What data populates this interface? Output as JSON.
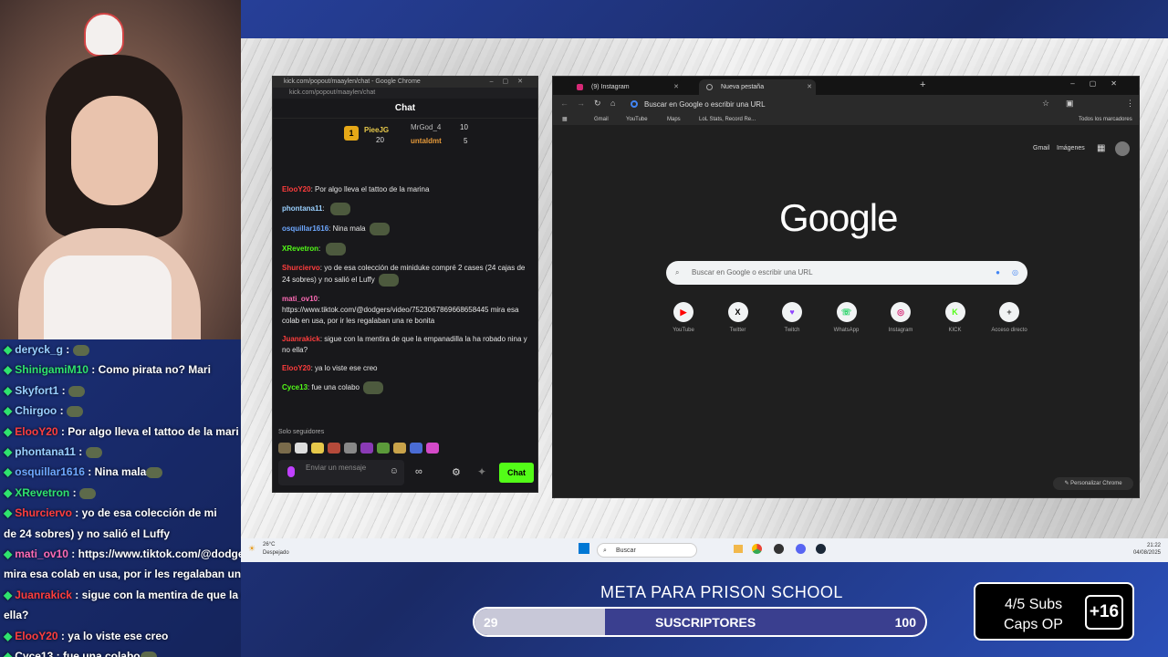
{
  "overlay_chat": [
    {
      "user": "deryck_g",
      "color": "#9ad0ff",
      "text": ""
    },
    {
      "user": "ShinigamiM10",
      "color": "#2fe36e",
      "text": "Como pirata no? Mari"
    },
    {
      "user": "Skyfort1",
      "color": "#9ad0ff",
      "text": ""
    },
    {
      "user": "Chirgoo",
      "color": "#9ad0ff",
      "text": ""
    },
    {
      "user": "ElooY20",
      "color": "#ff3d3d",
      "text": "Por algo lleva el tattoo de la mari"
    },
    {
      "user": "phontana11",
      "color": "#9ad0ff",
      "text": ""
    },
    {
      "user": "osquillar1616",
      "color": "#6ea8ff",
      "text": "Nina mala"
    },
    {
      "user": "XRevetron",
      "color": "#2fe36e",
      "text": ""
    },
    {
      "user": "Shurciervo",
      "color": "#ff3d3d",
      "text": "yo de esa colección de mi"
    },
    {
      "user": "",
      "color": "#fff",
      "text": "de 24 sobres) y no salió el Luffy"
    },
    {
      "user": "mati_ov10",
      "color": "#ff6bb5",
      "text": "https://www.tiktok.com/@dodger"
    },
    {
      "user": "",
      "color": "#fff",
      "text": "mira esa colab en usa, por ir les regalaban una"
    },
    {
      "user": "Juanrakick",
      "color": "#ff3d3d",
      "text": "sigue con la mentira de que la em"
    },
    {
      "user": "",
      "color": "#fff",
      "text": "ella?"
    },
    {
      "user": "ElooY20",
      "color": "#ff3d3d",
      "text": "ya lo viste ese creo"
    },
    {
      "user": "Cyce13",
      "color": "#fff",
      "text": "fue una colabo"
    }
  ],
  "kick_window": {
    "title": "kick.com/popout/maaylen/chat - Google Chrome",
    "url": "kick.com/popout/maaylen/chat",
    "chat_title": "Chat",
    "gifters": [
      {
        "name": "PieeJG",
        "count": "20",
        "rank": "1"
      },
      {
        "name": "MrGod_4",
        "count": "10"
      },
      {
        "name": "untaldmt",
        "count": "5"
      }
    ],
    "messages": [
      {
        "user": "ElooY20",
        "color": "#ff3d3d",
        "text": "Por algo lleva el tattoo de la marina"
      },
      {
        "user": "phontana11",
        "color": "#9ad0ff",
        "text": ""
      },
      {
        "user": "osquillar1616",
        "color": "#6ea8ff",
        "text": "Nina mala"
      },
      {
        "user": "XRevetron",
        "color": "#53fc18",
        "text": ""
      },
      {
        "user": "Shurciervo",
        "color": "#ff3d3d",
        "text": "yo de esa colección de miniduke compré 2 cases (24 cajas de 24 sobres) y no salió el Luffy"
      },
      {
        "user": "mati_ov10",
        "color": "#ff6bb5",
        "text": "https://www.tiktok.com/@dodgers/video/7523067869668658445 mira esa colab en usa, por ir les regalaban una re bonita"
      },
      {
        "user": "Juanrakick",
        "color": "#ff3d3d",
        "text": "sigue con la mentira de que la empanadilla la ha robado nina y no ella?"
      },
      {
        "user": "ElooY20",
        "color": "#ff3d3d",
        "text": "ya lo viste ese creo"
      },
      {
        "user": "Cyce13",
        "color": "#53fc18",
        "text": "fue una colabo"
      }
    ],
    "followers_only": "Solo seguidores",
    "input_placeholder": "Enviar un mensaje",
    "send_label": "Chat"
  },
  "chrome": {
    "tabs": [
      {
        "label": "(9) Instagram",
        "active": false
      },
      {
        "label": "Nueva pestaña",
        "active": true
      }
    ],
    "omnibox": "Buscar en Google o escribir una URL",
    "bookmarks": [
      "Gmail",
      "YouTube",
      "Maps",
      "LoL Stats, Record Re..."
    ],
    "bookmarks_all": "Todos los marcadores",
    "top_links": [
      "Gmail",
      "Imágenes"
    ],
    "search_placeholder": "Buscar en Google o escribir una URL",
    "logo": "Google",
    "shortcuts": [
      {
        "label": "YouTube",
        "color": "#ff0000",
        "glyph": "▶"
      },
      {
        "label": "Twitter",
        "color": "#000000",
        "glyph": "X"
      },
      {
        "label": "Twitch",
        "color": "#9146ff",
        "glyph": "♥"
      },
      {
        "label": "WhatsApp",
        "color": "#25d366",
        "glyph": "☏"
      },
      {
        "label": "Instagram",
        "color": "#d62976",
        "glyph": "◎"
      },
      {
        "label": "KICK",
        "color": "#53fc18",
        "glyph": "K"
      },
      {
        "label": "Acceso directo",
        "color": "#3a3a3a",
        "glyph": "+"
      }
    ],
    "customize": "Personalizar Chrome"
  },
  "taskbar": {
    "weather_temp": "26°C",
    "weather_desc": "Despejado",
    "search": "Buscar",
    "time": "21:22",
    "date": "04/08/2025"
  },
  "goal": {
    "title": "META PARA PRISON SCHOOL",
    "current": "29",
    "label": "SUSCRIPTORES",
    "target": "100",
    "progress": 0.29
  },
  "subs_box": {
    "line1": "4/5 Subs",
    "line2": "Caps OP",
    "plus": "+16"
  }
}
